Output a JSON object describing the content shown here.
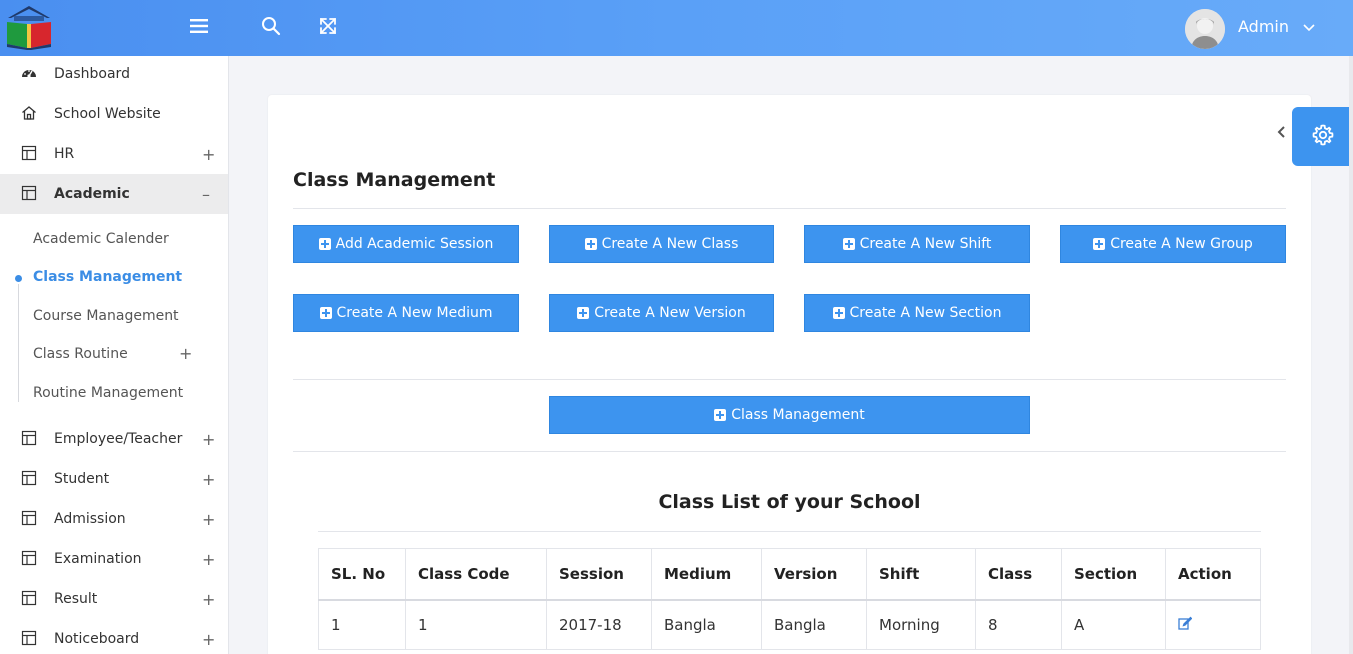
{
  "header": {
    "logo_icon": "school-book-logo-icon",
    "menu_icon": "hamburger-icon",
    "search_icon": "search-icon",
    "fullscreen_icon": "expand-icon",
    "user_name": "Admin",
    "accent": "#4a8ff0"
  },
  "sidebar": {
    "items": [
      {
        "label": "Dashboard",
        "icon": "dashboard-icon"
      },
      {
        "label": "School Website",
        "icon": "home-icon"
      },
      {
        "label": "HR",
        "icon": "table-icon",
        "toggle": "+"
      },
      {
        "label": "Academic",
        "icon": "table-icon",
        "toggle": "–"
      },
      {
        "label": "Employee/Teacher",
        "icon": "table-icon",
        "toggle": "+"
      },
      {
        "label": "Student",
        "icon": "table-icon",
        "toggle": "+"
      },
      {
        "label": "Admission",
        "icon": "table-icon",
        "toggle": "+"
      },
      {
        "label": "Examination",
        "icon": "table-icon",
        "toggle": "+"
      },
      {
        "label": "Result",
        "icon": "table-icon",
        "toggle": "+"
      },
      {
        "label": "Noticeboard",
        "icon": "table-icon",
        "toggle": "+"
      }
    ],
    "academic_sub": [
      {
        "label": "Academic Calender"
      },
      {
        "label": "Class Management"
      },
      {
        "label": "Course Management"
      },
      {
        "label": "Class Routine",
        "toggle": "+"
      },
      {
        "label": "Routine Management"
      }
    ]
  },
  "main": {
    "title": "Class Management",
    "buttons": [
      "Add Academic Session",
      "Create A New Class",
      "Create A New Shift",
      "Create A New Group",
      "Create A New Medium",
      "Create A New Version",
      "Create A New Section"
    ],
    "class_management_button": "Class Management",
    "list_title": "Class List of your School",
    "table": {
      "headers": [
        "SL. No",
        "Class Code",
        "Session",
        "Medium",
        "Version",
        "Shift",
        "Class",
        "Section",
        "Action"
      ],
      "rows": [
        [
          "1",
          "1",
          "2017-18",
          "Bangla",
          "Bangla",
          "Morning",
          "8",
          "A",
          "edit-icon"
        ]
      ]
    }
  },
  "settings_icon": "gear-icon",
  "collapse_icon": "chevron-left-icon"
}
